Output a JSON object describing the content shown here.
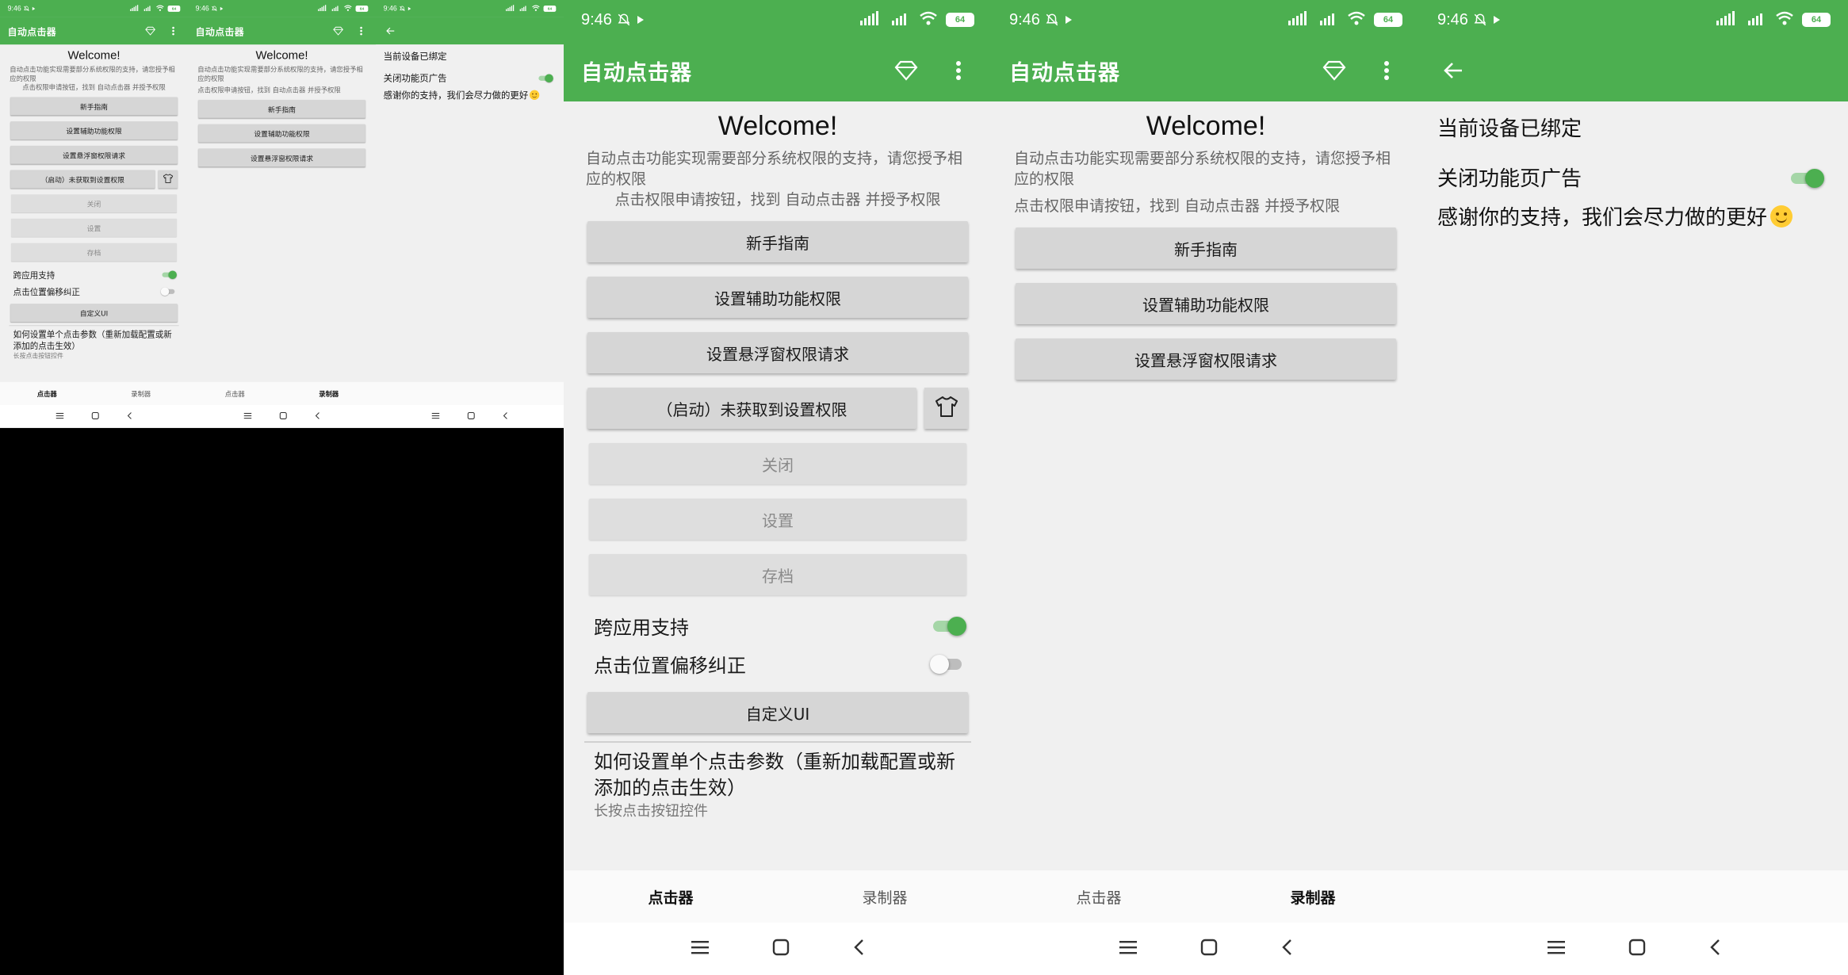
{
  "status": {
    "time": "9:46",
    "battery": "64"
  },
  "app": {
    "title": "自动点击器"
  },
  "main": {
    "welcome": "Welcome!",
    "description": "自动点击功能实现需要部分系统权限的支持，请您授予相应的权限",
    "instruction": "点击权限申请按钮，找到 自动点击器 并授予权限",
    "buttons": {
      "guide": "新手指南",
      "accessibility": "设置辅助功能权限",
      "overlay": "设置悬浮窗权限请求",
      "start": "（启动）未获取到设置权限",
      "close": "关闭",
      "settings": "设置",
      "save": "存档",
      "custom_ui": "自定义UI"
    },
    "toggles": {
      "cross_app": {
        "label": "跨应用支持",
        "on": true
      },
      "offset_fix": {
        "label": "点击位置偏移纠正",
        "on": false
      }
    },
    "help_title": "如何设置单个点击参数（重新加载配置或新添加的点击生效）",
    "help_sub": "长按点击按钮控件"
  },
  "nav": {
    "clicker": "点击器",
    "recorder": "录制器"
  },
  "settings_page": {
    "bound": "当前设备已绑定",
    "ad_label": "关闭功能页广告",
    "ad_on": true,
    "thanks": "感谢你的支持，我们会尽力做的更好"
  },
  "icons": [
    "diamond-icon",
    "more-vert-icon",
    "back-arrow-icon",
    "tshirt-icon",
    "menu-icon",
    "home-icon",
    "nav-back-icon",
    "mute-icon",
    "wifi-icon",
    "signal-icon"
  ],
  "colors": {
    "primary": "#4caf50",
    "background": "#f0f0f0",
    "button": "#d6d6d6"
  }
}
